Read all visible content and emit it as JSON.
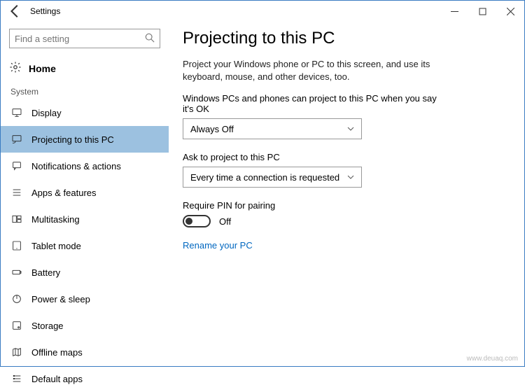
{
  "window": {
    "title": "Settings"
  },
  "search": {
    "placeholder": "Find a setting"
  },
  "home": {
    "label": "Home"
  },
  "section": "System",
  "nav": [
    {
      "label": "Display"
    },
    {
      "label": "Projecting to this PC"
    },
    {
      "label": "Notifications & actions"
    },
    {
      "label": "Apps & features"
    },
    {
      "label": "Multitasking"
    },
    {
      "label": "Tablet mode"
    },
    {
      "label": "Battery"
    },
    {
      "label": "Power & sleep"
    },
    {
      "label": "Storage"
    },
    {
      "label": "Offline maps"
    },
    {
      "label": "Default apps"
    }
  ],
  "page": {
    "title": "Projecting to this PC",
    "desc": "Project your Windows phone or PC to this screen, and use its keyboard, mouse, and other devices, too.",
    "setting1_label": "Windows PCs and phones can project to this PC when you say it's OK",
    "setting1_value": "Always Off",
    "setting2_label": "Ask to project to this PC",
    "setting2_value": "Every time a connection is requested",
    "setting3_label": "Require PIN for pairing",
    "setting3_value": "Off",
    "rename_link": "Rename your PC"
  },
  "watermark": "www.deuaq.com"
}
